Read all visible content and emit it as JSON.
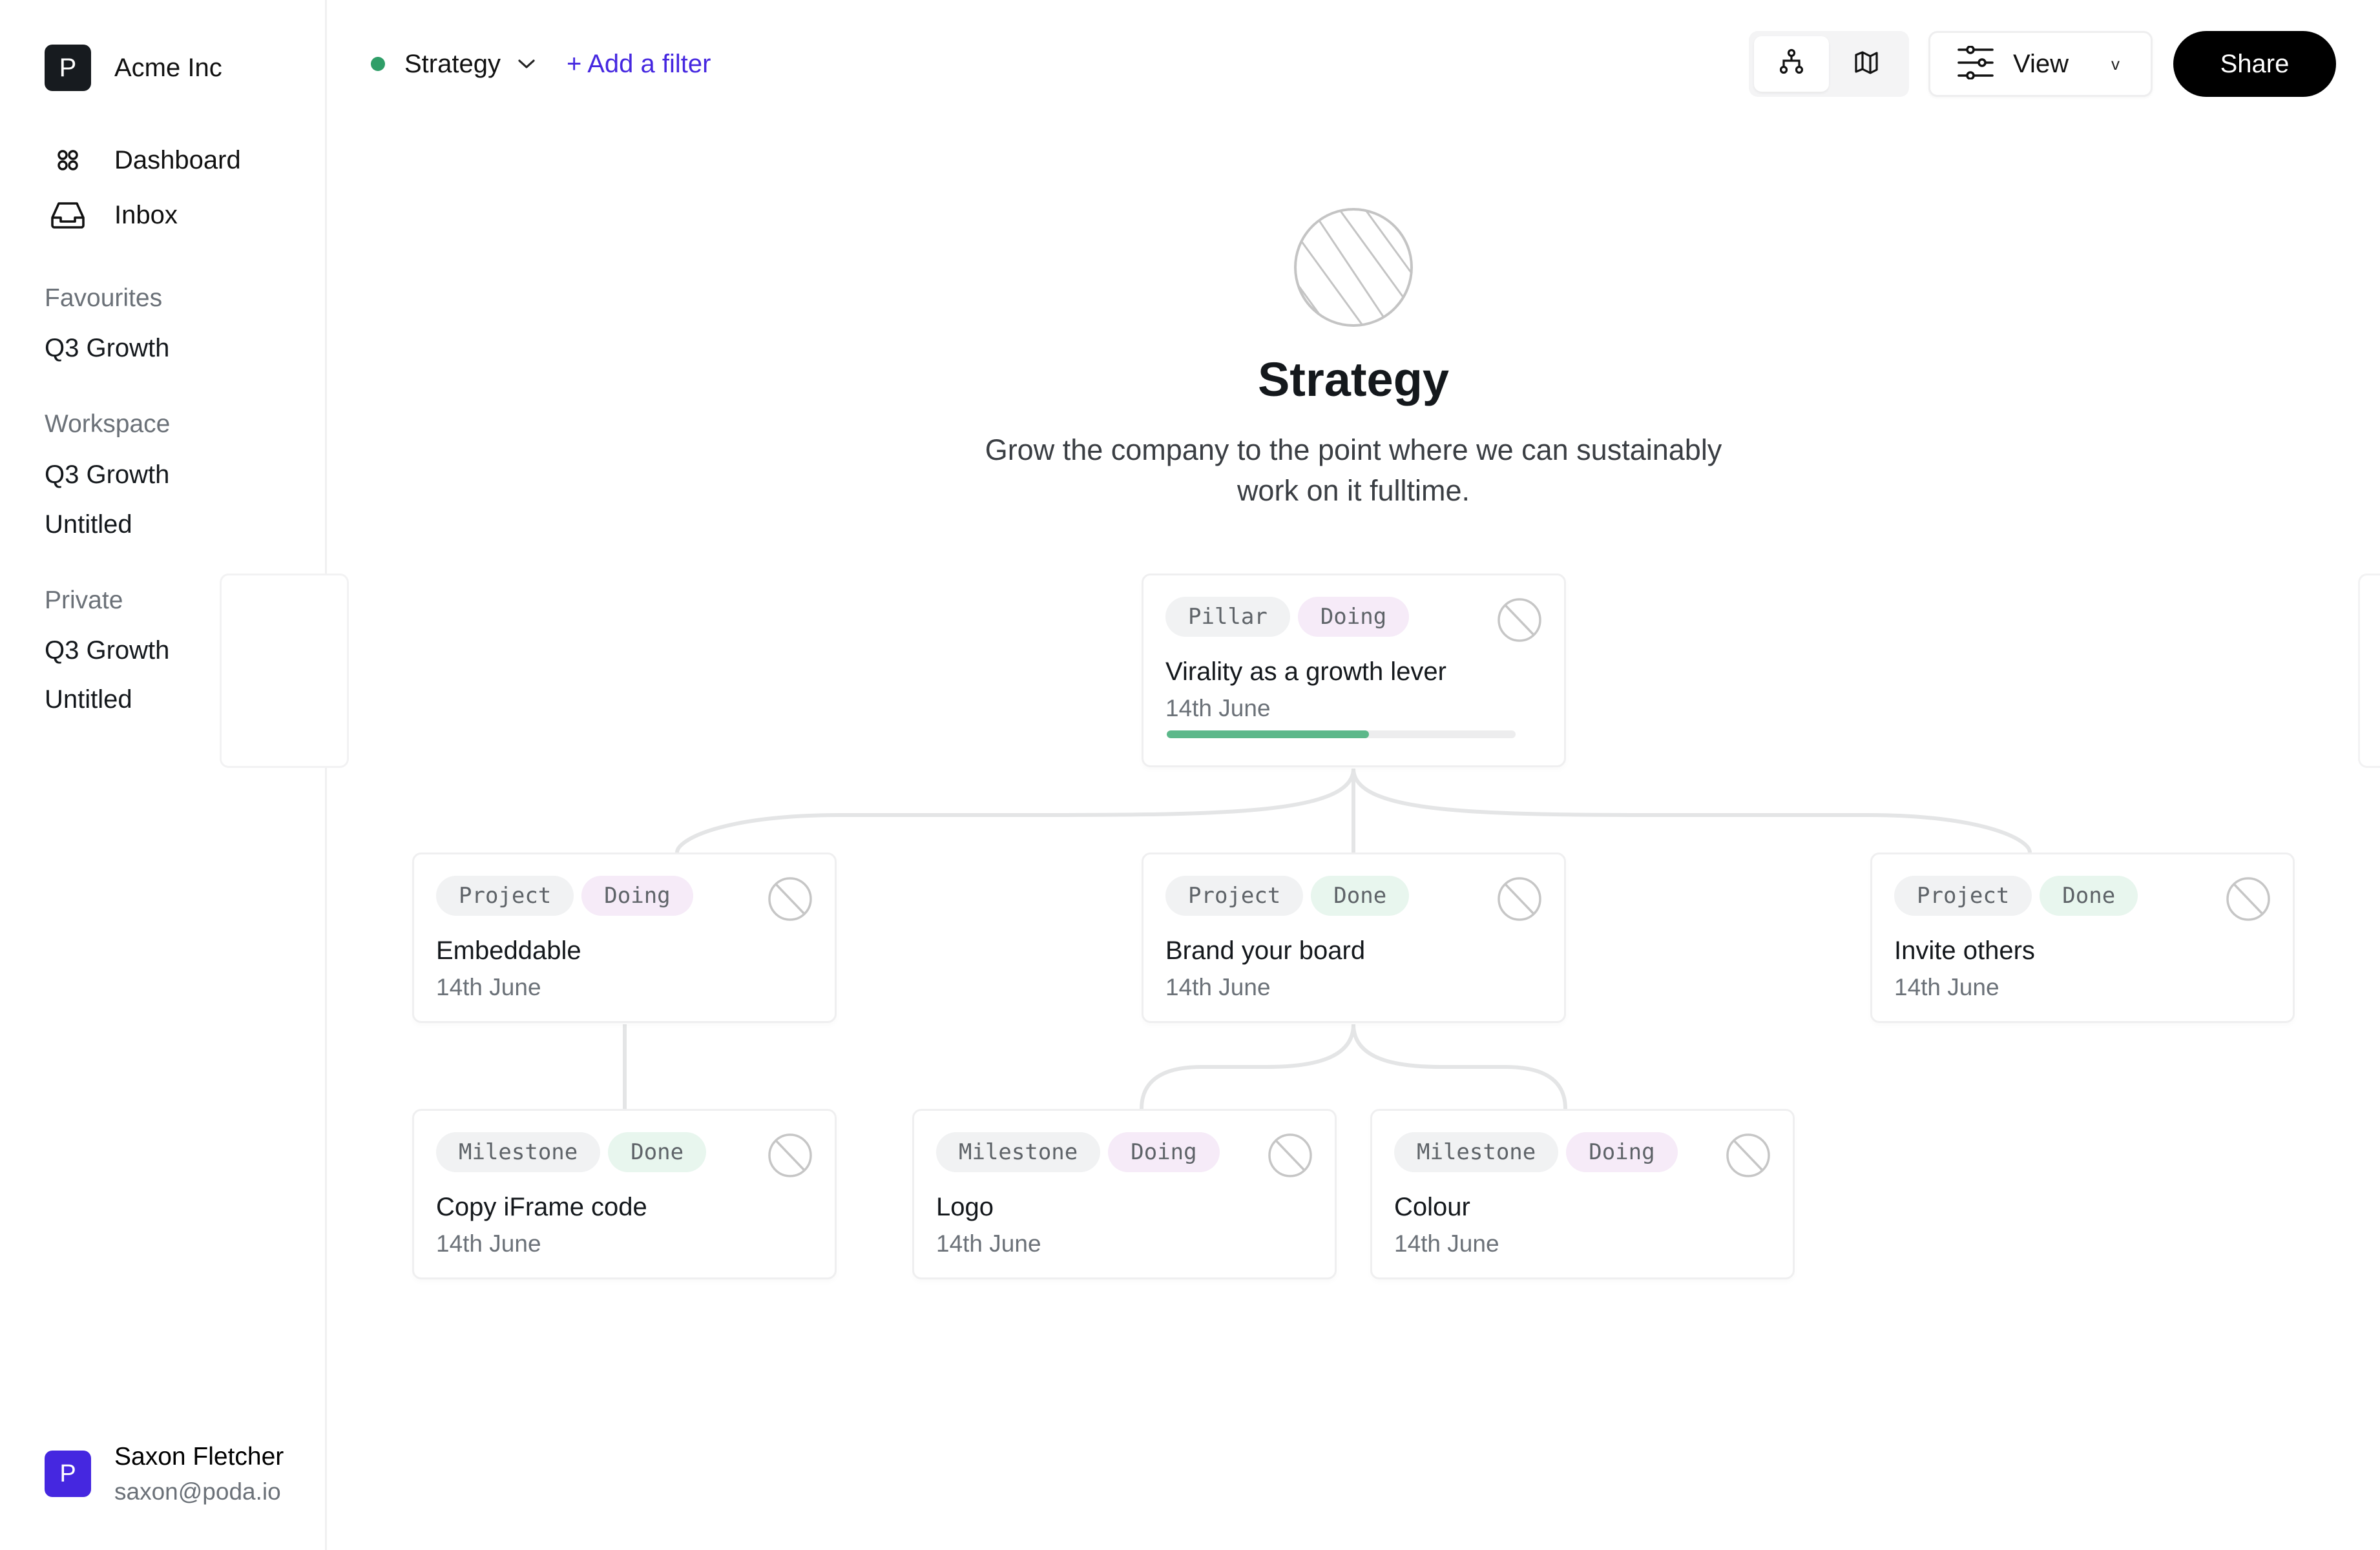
{
  "sidebar": {
    "org": {
      "initial": "P",
      "name": "Acme Inc"
    },
    "nav": [
      {
        "label": "Dashboard",
        "icon": "dashboard-icon"
      },
      {
        "label": "Inbox",
        "icon": "inbox-icon"
      }
    ],
    "sections": [
      {
        "heading": "Favourites",
        "items": [
          "Q3 Growth"
        ]
      },
      {
        "heading": "Workspace",
        "items": [
          "Q3 Growth",
          "Untitled"
        ]
      },
      {
        "heading": "Private",
        "items": [
          "Q3 Growth",
          "Untitled"
        ]
      }
    ],
    "user": {
      "initial": "P",
      "name": "Saxon Fletcher",
      "email": "saxon@poda.io"
    }
  },
  "topbar": {
    "board": {
      "name": "Strategy",
      "status_color": "#2f9e68"
    },
    "add_filter_label": "+ Add a filter",
    "view_modes": [
      {
        "name": "tree-view",
        "icon": "hierarchy-icon",
        "active": true
      },
      {
        "name": "map-view",
        "icon": "map-icon",
        "active": false
      }
    ],
    "view_label": "View",
    "view_caret": "v",
    "share_label": "Share"
  },
  "hero": {
    "title": "Strategy",
    "description": "Grow the company to the point where we can sustainably work on it fulltime."
  },
  "tree": {
    "pillar": {
      "type": "Pillar",
      "status": "Doing",
      "title": "Virality as a growth lever",
      "date": "14th June",
      "progress": 0.58
    },
    "projects": [
      {
        "type": "Project",
        "status": "Doing",
        "title": "Embeddable",
        "date": "14th June"
      },
      {
        "type": "Project",
        "status": "Done",
        "title": "Brand your board",
        "date": "14th June"
      },
      {
        "type": "Project",
        "status": "Done",
        "title": "Invite others",
        "date": "14th June"
      }
    ],
    "milestones": [
      {
        "type": "Milestone",
        "status": "Done",
        "title": "Copy iFrame code",
        "date": "14th June",
        "parent": "Embeddable"
      },
      {
        "type": "Milestone",
        "status": "Doing",
        "title": "Logo",
        "date": "14th June",
        "parent": "Brand your board"
      },
      {
        "type": "Milestone",
        "status": "Doing",
        "title": "Colour",
        "date": "14th June",
        "parent": "Brand your board"
      }
    ]
  },
  "colors": {
    "accent": "#4527e0",
    "doing_chip": "#f6ebf8",
    "done_chip": "#e8f6ee",
    "progress": "#5cb88a"
  }
}
